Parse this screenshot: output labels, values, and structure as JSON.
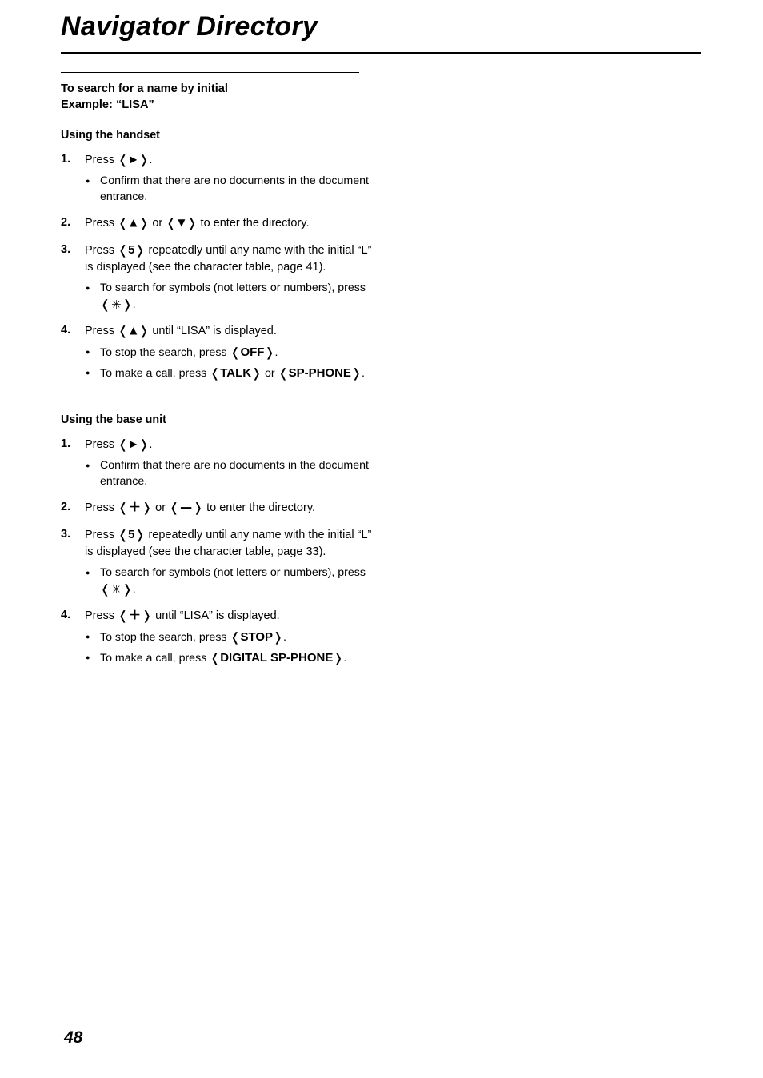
{
  "document": {
    "title": "Navigator Directory",
    "page_number": "48"
  },
  "section": {
    "heading": "To search for a name by initial",
    "example": "Example: “LISA”"
  },
  "handset": {
    "heading": "Using the handset",
    "steps": [
      {
        "num": "1.",
        "text_before": "Press ",
        "key": "▶",
        "text_after": ".",
        "bullets": [
          "Confirm that there are no documents in the document entrance."
        ]
      },
      {
        "num": "2.",
        "text_before": "Press ",
        "key": "▲",
        "middle": " or ",
        "key2": "▼",
        "text_after": " to enter the directory.",
        "bullets": []
      },
      {
        "num": "3.",
        "text_before": "Press ",
        "key": "5",
        "text_after": " repeatedly until any name with the initial “L” is displayed (see the character table, page 41).",
        "bullets": [
          {
            "before": "To search for symbols (not letters or numbers), press ",
            "key": "✳",
            "after": "."
          }
        ]
      },
      {
        "num": "4.",
        "text_before": "Press ",
        "key": "▲",
        "text_after": " until “LISA” is displayed.",
        "bullets": [
          {
            "before": "To stop the search, press ",
            "key": "OFF",
            "after": "."
          },
          {
            "before": "To make a call, press ",
            "key": "TALK",
            "middle": " or ",
            "key2": "SP-PHONE",
            "after": "."
          }
        ]
      }
    ]
  },
  "base_unit": {
    "heading": "Using the base unit",
    "steps": [
      {
        "num": "1.",
        "text_before": "Press ",
        "key": "▶",
        "text_after": ".",
        "bullets": [
          "Confirm that there are no documents in the document entrance."
        ]
      },
      {
        "num": "2.",
        "text_before": "Press ",
        "key": "＋",
        "middle": " or ",
        "key2": "—",
        "text_after": " to enter the directory.",
        "bullets": []
      },
      {
        "num": "3.",
        "text_before": "Press ",
        "key": "5",
        "text_after": " repeatedly until any name with the initial “L” is displayed (see the character table, page 33).",
        "bullets": [
          {
            "before": "To search for symbols (not letters or numbers), press ",
            "key": "✳",
            "after": "."
          }
        ]
      },
      {
        "num": "4.",
        "text_before": "Press ",
        "key": "＋",
        "text_after": " until “LISA” is displayed.",
        "bullets": [
          {
            "before": "To stop the search, press ",
            "key": "STOP",
            "after": "."
          },
          {
            "before": "To make a call, press ",
            "key": "DIGITAL SP-PHONE",
            "after": "."
          }
        ]
      }
    ]
  }
}
